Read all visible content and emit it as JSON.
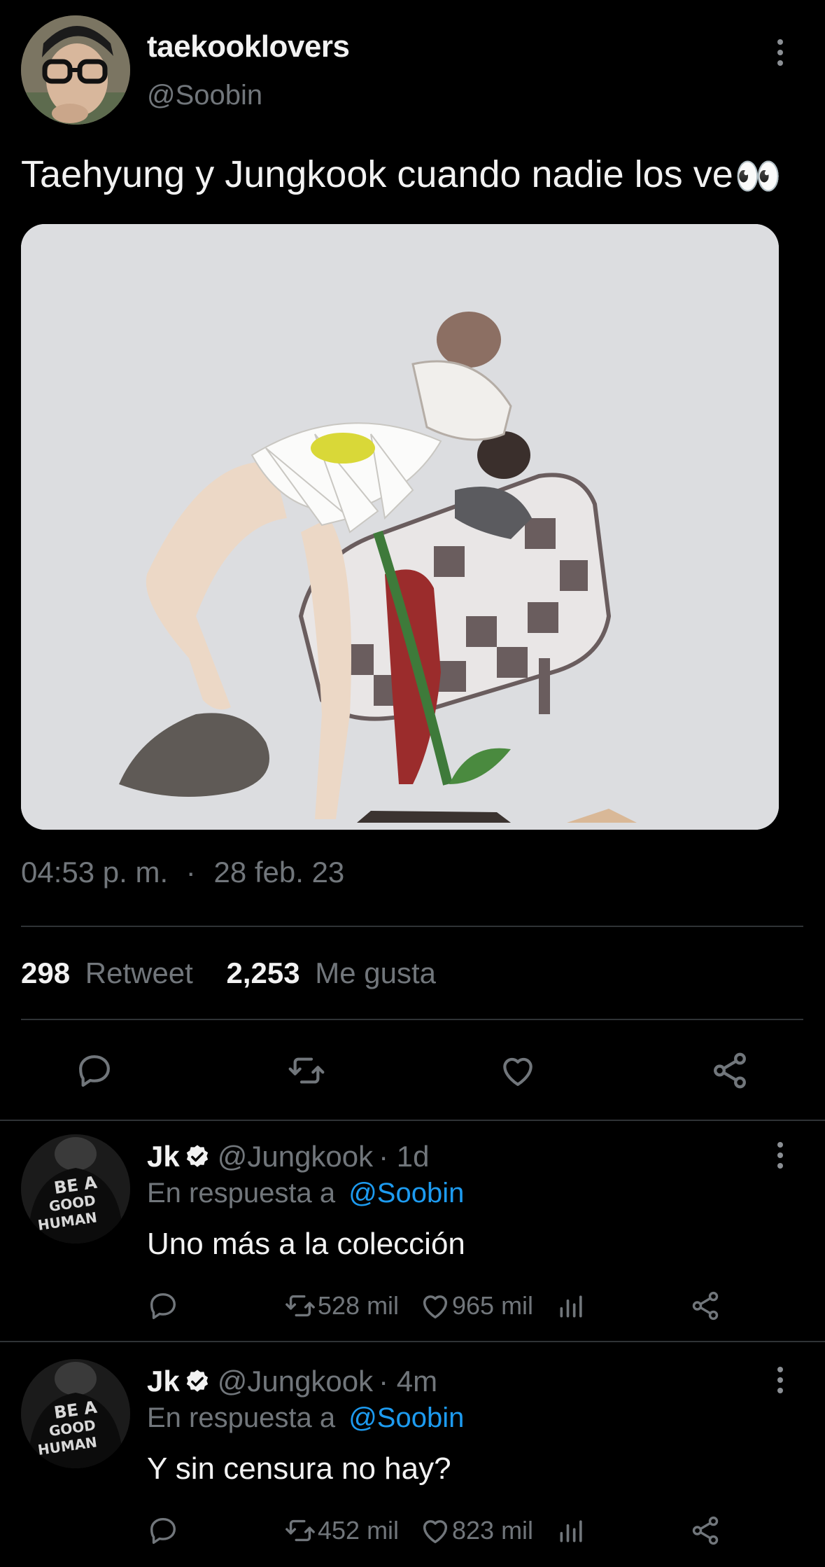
{
  "tweet": {
    "author_name": "taekooklovers",
    "author_handle": "@Soobin",
    "text": "Taehyung y Jungkook cuando nadie los ve",
    "emoji": "👀",
    "time": "04:53 p. m.",
    "separator": "·",
    "date": "28 feb. 23",
    "retweets_count": "298",
    "retweets_label": "Retweet",
    "likes_count": "2,253",
    "likes_label": "Me gusta"
  },
  "replies": [
    {
      "name": "Jk",
      "handle": "@Jungkook",
      "time": "· 1d",
      "reply_prefix": "En respuesta a",
      "reply_to": "@Soobin",
      "text": "Uno más a la colección",
      "retweets": "528 mil",
      "likes": "965 mil",
      "avatar_text": [
        "BE A",
        "GOOD",
        "HUMAN"
      ]
    },
    {
      "name": "Jk",
      "handle": "@Jungkook",
      "time": "· 4m",
      "reply_prefix": "En respuesta a",
      "reply_to": "@Soobin",
      "text": "Y sin censura no hay?",
      "retweets": "452 mil",
      "likes": "823 mil",
      "avatar_text": [
        "BE A",
        "GOOD",
        "HUMAN"
      ]
    }
  ],
  "icons": [
    "more-vertical-icon",
    "reply-icon",
    "retweet-icon",
    "like-icon",
    "share-icon",
    "views-icon",
    "verified-badge-icon"
  ],
  "colors": {
    "background": "#000000",
    "muted": "#71767b",
    "link": "#1d9bf0",
    "divider": "#2f3336"
  }
}
